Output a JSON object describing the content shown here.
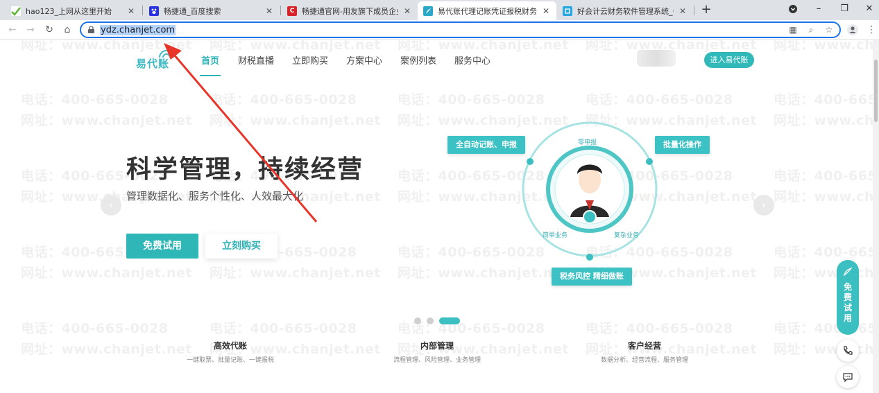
{
  "browser": {
    "tabs": [
      {
        "title": "hao123_上网从这里开始"
      },
      {
        "title": "畅捷通_百度搜索"
      },
      {
        "title": "畅捷通官网-用友旗下成员企业|专"
      },
      {
        "title": "易代账代理记账凭证报税财务软件"
      },
      {
        "title": "好会计云财务软件管理系统_会计"
      }
    ],
    "new_tab": "+",
    "url": "ydz.chanjet.com"
  },
  "watermark": {
    "phone": "电话：400-665-0028",
    "site": "网址：www.chanjet.net"
  },
  "site": {
    "logo_text": "易代账",
    "nav": [
      "首页",
      "财税直播",
      "立即购买",
      "方案中心",
      "案例列表",
      "服务中心"
    ],
    "enter_button": "进入易代账"
  },
  "hero": {
    "title": "科学管理，持续经营",
    "subtitle": "管理数据化、服务个性化、人效最大化",
    "trial_button": "免费试用",
    "buy_button": "立刻购买"
  },
  "diagram": {
    "pills": [
      "全自动记账、申报",
      "批量化操作",
      "税务风控 精细做账"
    ],
    "ring_labels": [
      "零申报",
      "简单业务",
      "复杂业务"
    ]
  },
  "carousel": {
    "slide_count": 3,
    "active_index": 2
  },
  "features": [
    {
      "title": "高效代账",
      "desc": "一键取票、批量记账、一键报税"
    },
    {
      "title": "内部管理",
      "desc": "流程管理、风险管理、业务管理"
    },
    {
      "title": "客户经营",
      "desc": "数据分析、经营流程、服务管理"
    }
  ],
  "side": {
    "trial_label": "免费试用"
  },
  "colors": {
    "brand": "#3cbfc1",
    "annotation_arrow": "#e8352a",
    "focus": "#1a73e8"
  }
}
